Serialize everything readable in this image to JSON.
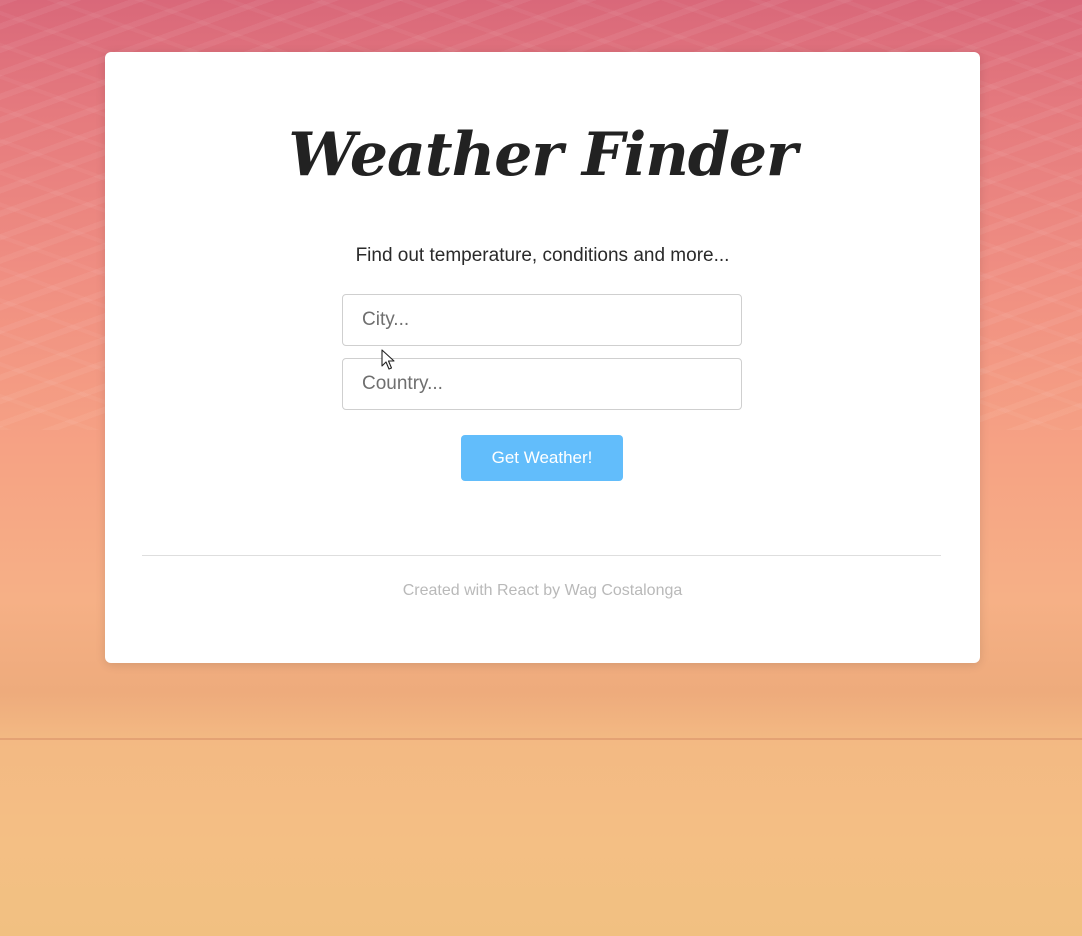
{
  "app": {
    "title": "Weather Finder",
    "subtitle": "Find out temperature, conditions and more..."
  },
  "form": {
    "city_placeholder": "City...",
    "city_value": "",
    "country_placeholder": "Country...",
    "country_value": "",
    "submit_label": "Get Weather!"
  },
  "footer": {
    "credit": "Created with React by Wag Costalonga"
  },
  "colors": {
    "button": "#62bdfb",
    "card": "#ffffff",
    "sky_top": "#d9687a",
    "sand": "#f1c081"
  },
  "icons": [
    "mouse-pointer-icon"
  ]
}
